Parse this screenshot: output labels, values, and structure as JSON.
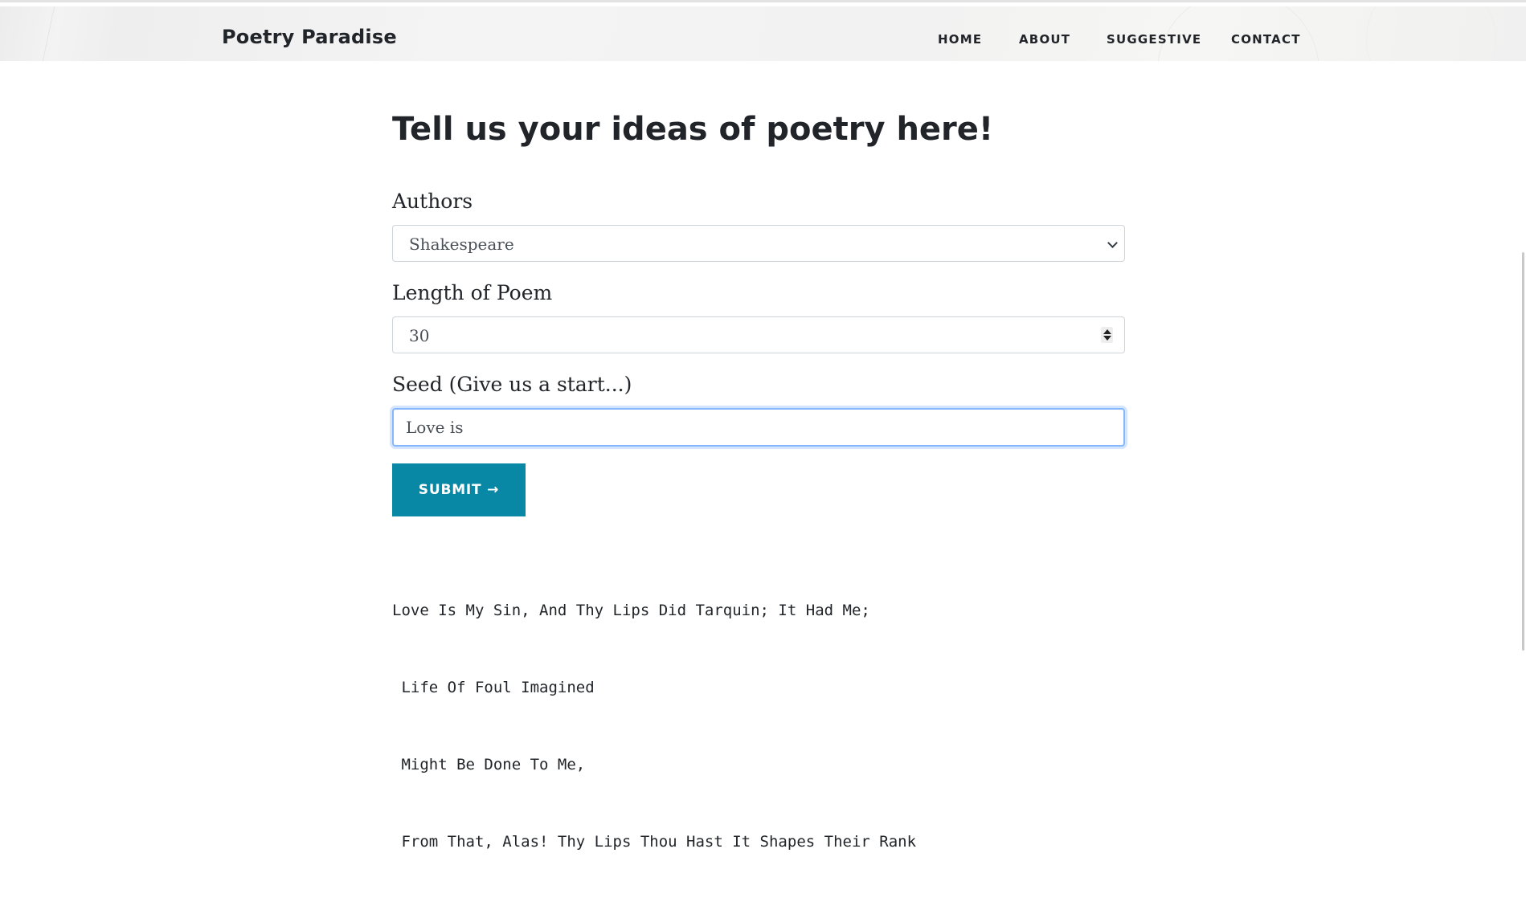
{
  "site": {
    "brand": "Poetry Paradise",
    "nav": [
      "HOME",
      "ABOUT",
      "SUGGESTIVE",
      "CONTACT"
    ]
  },
  "form": {
    "heading": "Tell us your ideas of poetry here!",
    "authors_label": "Authors",
    "authors_selected": "Shakespeare",
    "length_label": "Length of Poem",
    "length_value": "30",
    "seed_label": "Seed (Give us a start...)",
    "seed_value": "Love is",
    "submit_label": "SUBMIT →"
  },
  "output": {
    "lines": [
      "Love Is My Sin, And Thy Lips Did Tarquin; It Had Me;",
      " Life Of Foul Imagined",
      " Might Be Done To Me,",
      " From That, Alas! Thy Lips Thou Hast It Shapes Their Rank"
    ]
  },
  "icons": {
    "select": "chevron-down-icon",
    "number": "spinner-icon"
  }
}
